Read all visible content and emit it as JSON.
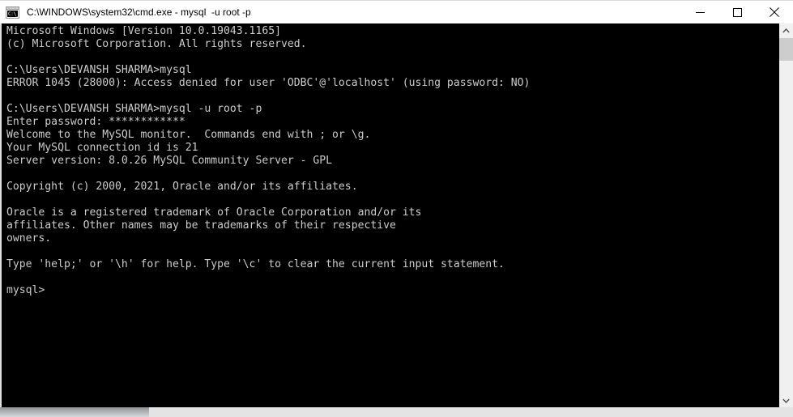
{
  "window": {
    "title": "C:\\WINDOWS\\system32\\cmd.exe - mysql  -u root -p",
    "icon": "cmd-console-icon",
    "icon_glyph": "C:\\_",
    "controls": {
      "minimize_label": "Minimize",
      "maximize_label": "Maximize",
      "close_label": "Close"
    },
    "colors": {
      "titlebar_background": "#ffffff",
      "titlebar_text": "#000000",
      "console_background": "#000000",
      "console_text": "#cccccc",
      "scrollbar_track": "#f0f0f0",
      "scrollbar_thumb": "#cdcdcd"
    }
  },
  "console": {
    "lines": [
      "Microsoft Windows [Version 10.0.19043.1165]",
      "(c) Microsoft Corporation. All rights reserved.",
      "",
      "C:\\Users\\DEVANSH SHARMA>mysql",
      "ERROR 1045 (28000): Access denied for user 'ODBC'@'localhost' (using password: NO)",
      "",
      "C:\\Users\\DEVANSH SHARMA>mysql -u root -p",
      "Enter password: ************",
      "Welcome to the MySQL monitor.  Commands end with ; or \\g.",
      "Your MySQL connection id is 21",
      "Server version: 8.0.26 MySQL Community Server - GPL",
      "",
      "Copyright (c) 2000, 2021, Oracle and/or its affiliates.",
      "",
      "Oracle is a registered trademark of Oracle Corporation and/or its",
      "affiliates. Other names may be trademarks of their respective",
      "owners.",
      "",
      "Type 'help;' or '\\h' for help. Type '\\c' to clear the current input statement.",
      "",
      "mysql>"
    ],
    "prompt": "mysql>",
    "current_directory": "C:\\Users\\DEVANSH SHARMA",
    "mysql_version": "8.0.26",
    "mysql_edition": "MySQL Community Server - GPL",
    "connection_id": "21",
    "windows_version": "10.0.19043.1165",
    "error_code": "1045",
    "error_sqlstate": "28000",
    "password_mask": "************"
  },
  "scrollbars": {
    "vertical": {
      "up_arrow": "▲",
      "down_arrow": "▼",
      "thumb_position_percent": 4
    },
    "horizontal": {
      "thumb_width_percent": 19
    }
  }
}
